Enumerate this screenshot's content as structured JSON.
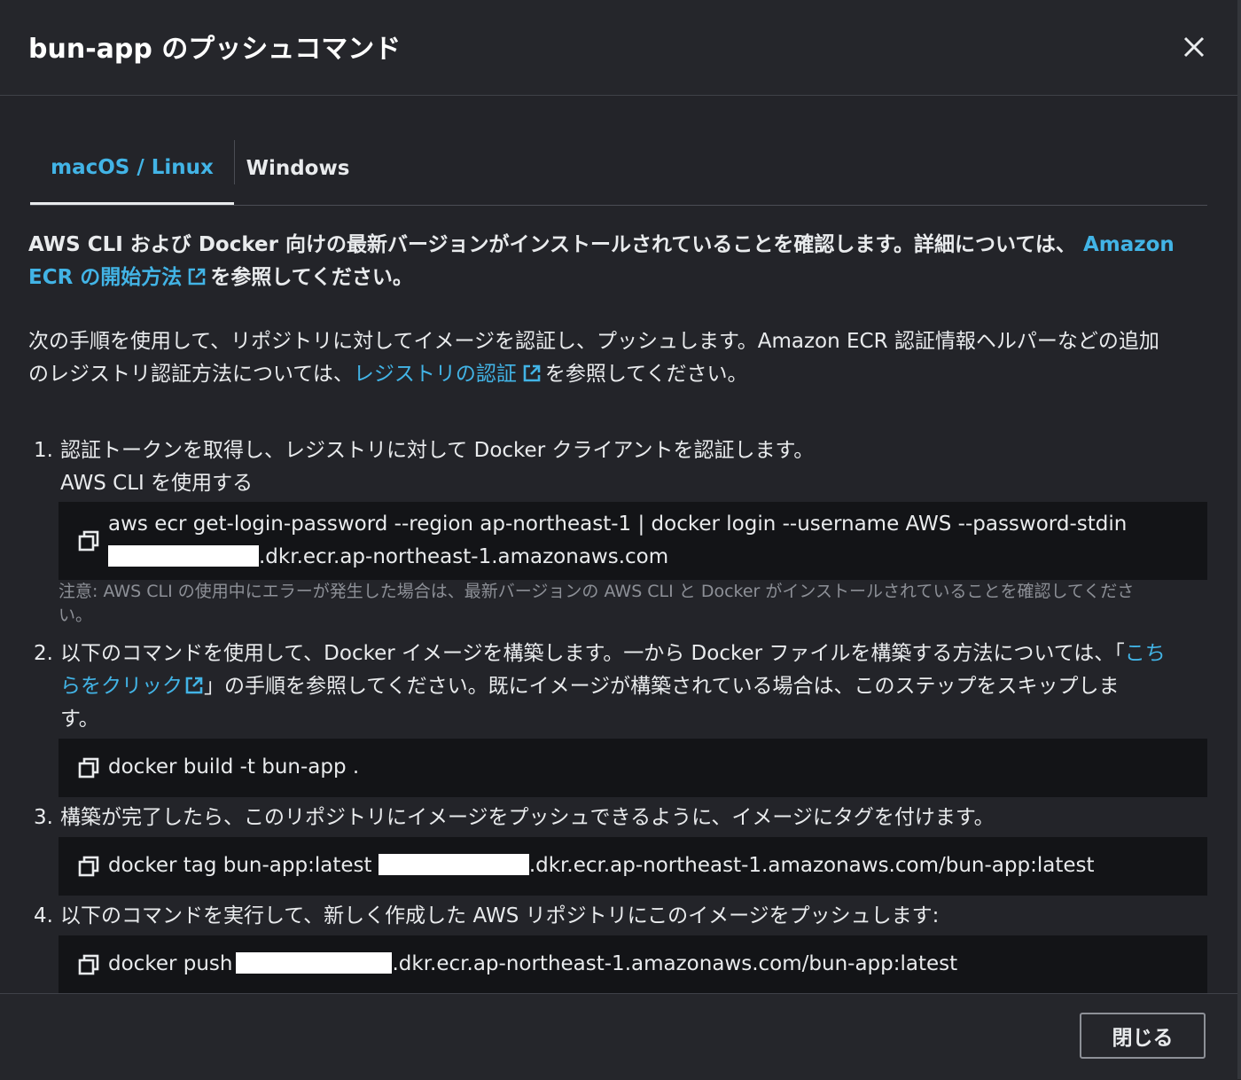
{
  "modal": {
    "title": "bun-app のプッシュコマンド",
    "close_icon": "close-icon"
  },
  "tabs": [
    {
      "label": "macOS / Linux",
      "active": true
    },
    {
      "label": "Windows",
      "active": false
    }
  ],
  "intro": {
    "text": "AWS CLI および Docker 向けの最新バージョンがインストールされていることを確認します。詳細については、",
    "link_line1": "Amazon",
    "link_line2": "ECR の開始方法",
    "after": "を参照してください。"
  },
  "info": {
    "line1": "次の手順を使用して、リポジトリに対してイメージを認証し、プッシュします。Amazon ECR 認証情報ヘルパーなどの追加",
    "line2_before": "のレジストリ認証方法については、",
    "link": "レジストリの認証",
    "line2_after": "を参照してください。"
  },
  "steps": [
    {
      "num": "1.",
      "text": "認証トークンを取得し、レジストリに対して Docker クライアントを認証します。",
      "subtext": "AWS CLI を使用する",
      "command_line1": "aws ecr get-login-password --region ap-northeast-1 | docker login --username AWS --password-stdin",
      "command_line2": ".dkr.ecr.ap-northeast-1.amazonaws.com",
      "note_line1": "注意: AWS CLI の使用中にエラーが発生した場合は、最新バージョンの AWS CLI と Docker がインストールされていることを確認してくださ",
      "note_line2": "い。"
    },
    {
      "num": "2.",
      "line1": "以下のコマンドを使用して、Docker イメージを構築します。一から Docker ファイルを構築する方法については、「",
      "link1": "こち",
      "link2": "らをクリック",
      "line2_after": "」の手順を参照してください。既にイメージが構築されている場合は、このステップをスキップしま",
      "line3": "す。",
      "command": "docker build -t bun-app ."
    },
    {
      "num": "3.",
      "text": "構築が完了したら、このリポジトリにイメージをプッシュできるように、イメージにタグを付けます。",
      "command_before": "docker tag bun-app:latest",
      "command_after": ".dkr.ecr.ap-northeast-1.amazonaws.com/bun-app:latest"
    },
    {
      "num": "4.",
      "text": "以下のコマンドを実行して、新しく作成した AWS リポジトリにこのイメージをプッシュします:",
      "command_before": "docker push",
      "command_after": ".dkr.ecr.ap-northeast-1.amazonaws.com/bun-app:latest"
    }
  ],
  "footer": {
    "close_label": "閉じる"
  },
  "colors": {
    "accent": "#42b4e6",
    "background": "#232429",
    "code_background": "#131417"
  }
}
